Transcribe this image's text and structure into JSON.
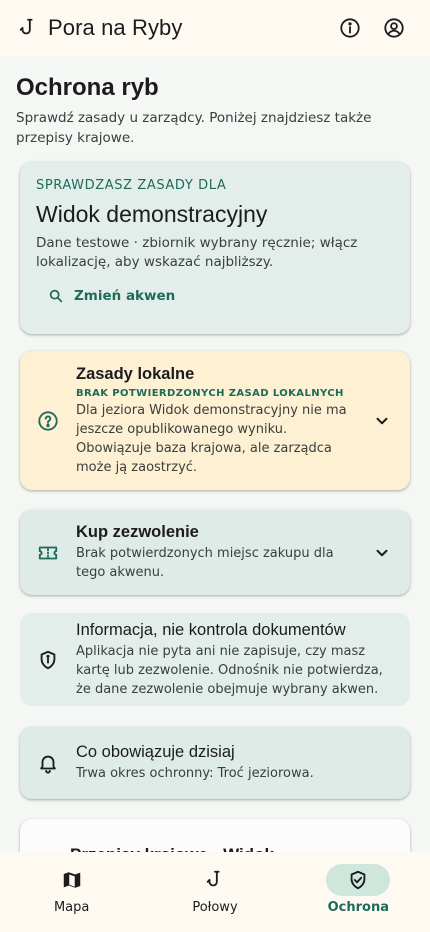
{
  "app": {
    "title": "Pora na Ryby",
    "icons": [
      "hook-icon",
      "info-icon",
      "account-icon"
    ]
  },
  "page": {
    "title": "Ochrona ryb",
    "subtitle": "Sprawdź zasady u zarządcy. Poniżej znajdziesz także przepisy krajowe."
  },
  "current_water": {
    "overline": "SPRAWDZASZ ZASADY DLA",
    "name": "Widok demonstracyjny",
    "description": "Dane testowe · zbiornik wybrany ręcznie; włącz lokalizację, aby wskazać najbliższy.",
    "change_label": "Zmień akwen"
  },
  "local_rules": {
    "title": "Zasady lokalne",
    "status": "BRAK POTWIERDZONYCH ZASAD LOKALNYCH",
    "text": "Dla jeziora Widok demonstracyjny nie ma jeszcze opublikowanego wyniku. Obowiązuje baza krajowa, ale zarządca może ją zaostrzyć.",
    "accent": "#fdf0d3"
  },
  "permit": {
    "title": "Kup zezwolenie",
    "text": "Brak potwierdzonych miejsc zakupu dla tego akwenu."
  },
  "notice": {
    "title": "Informacja, nie kontrola dokumentów",
    "text": "Aplikacja nie pyta ani nie zapisuje, czy masz kartę lub zezwolenie. Odnośnik nie potwierdza, że dane zezwolenie obejmuje wybrany akwen."
  },
  "today": {
    "title": "Co obowiązuje dzisiaj",
    "text": "Trwa okres ochronny: Troć jeziorowa."
  },
  "national": {
    "title": "Przepisy krajowe · Widok"
  },
  "nav": {
    "items": [
      {
        "label": "Mapa",
        "icon": "map-icon"
      },
      {
        "label": "Połowy",
        "icon": "hook-icon"
      },
      {
        "label": "Ochrona",
        "icon": "shield-check-icon",
        "active": true
      }
    ]
  },
  "colors": {
    "accent": "#1e6b5a",
    "background": "#f5f7f4",
    "card": "#deebe6",
    "warning_card": "#fdf0d3"
  }
}
